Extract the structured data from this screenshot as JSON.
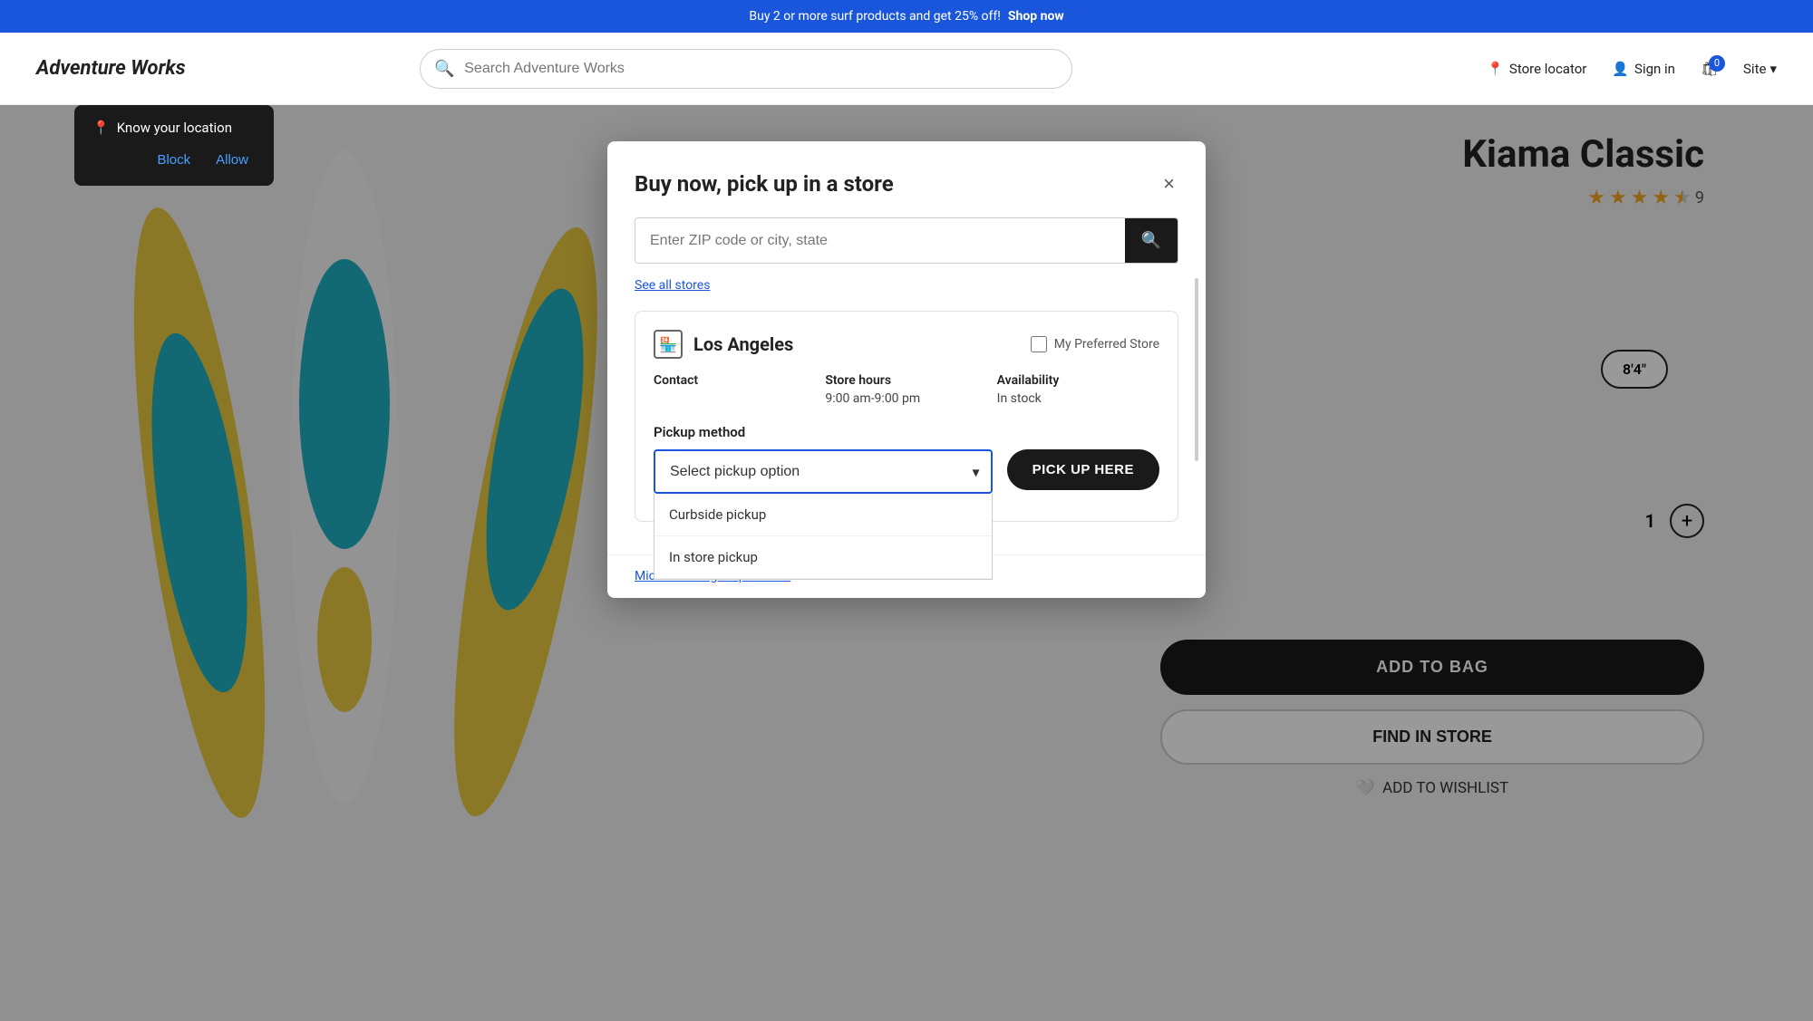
{
  "promo": {
    "text": "Buy 2 or more surf products and get 25% off!",
    "link_text": "Shop now"
  },
  "header": {
    "logo": "Adventure Works",
    "search_placeholder": "Search Adventure Works",
    "store_locator": "Store locator",
    "sign_in": "Sign in",
    "cart_count": "0",
    "site": "Site"
  },
  "product": {
    "title": "Kiama Classic",
    "rating_count": "9",
    "size_label": "8'4\"",
    "quantity": "1",
    "add_to_bag": "ADD TO BAG",
    "find_in_store": "FIND IN STORE",
    "add_to_wishlist": "ADD TO WISHLIST"
  },
  "location_popup": {
    "title": "Know your location",
    "block": "Block",
    "allow": "Allow"
  },
  "modal": {
    "title": "Buy now, pick up in a store",
    "zip_placeholder": "Enter ZIP code or city, state",
    "see_all_stores": "See all stores",
    "close_label": "×",
    "store": {
      "name": "Los Angeles",
      "preferred_store_label": "My Preferred Store",
      "contact_label": "Contact",
      "hours_label": "Store hours",
      "hours_value": "9:00 am-9:00 pm",
      "availability_label": "Availability",
      "availability_value": "In stock",
      "pickup_method_label": "Pickup method",
      "pickup_placeholder": "Select pickup option",
      "pickup_options": [
        "Curbside pickup",
        "In store pickup"
      ],
      "pick_up_here": "PICK UP HERE"
    },
    "footer_link": "Microsoft Bing Maps Terms"
  }
}
